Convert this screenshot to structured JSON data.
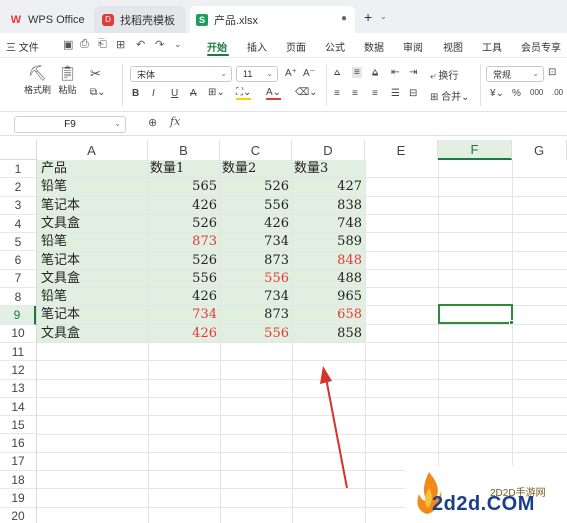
{
  "tabs": {
    "wps": "WPS Office",
    "template": "找稻壳模板",
    "file": "产品.xlsx",
    "file_badge": "S",
    "template_badge": "D",
    "wps_badge": "W",
    "new_tab": "+",
    "modified_dot": "●"
  },
  "menu": {
    "file": "三 文件",
    "items": [
      "开始",
      "插入",
      "页面",
      "公式",
      "数据",
      "审阅",
      "视图",
      "工具",
      "会员专享"
    ],
    "active": "开始"
  },
  "ribbon": {
    "format_painter": "格式刷",
    "paste": "粘贴",
    "font_name": "宋体",
    "font_size": "11",
    "number_format": "常规",
    "wrap_text": "换行",
    "merge": "合并",
    "bold": "B",
    "italic": "I",
    "underline": "U",
    "strike": "A",
    "percent": "%",
    "thousands": "000",
    "currency": "¥",
    "decimal": ".00"
  },
  "formula_bar": {
    "cell_ref": "F9",
    "fx": "fx",
    "value": ""
  },
  "columns": [
    "A",
    "B",
    "C",
    "D",
    "E",
    "F",
    "G"
  ],
  "selected_column": "F",
  "rows": [
    "1",
    "2",
    "3",
    "4",
    "5",
    "6",
    "7",
    "8",
    "9",
    "10",
    "11",
    "12",
    "13",
    "14",
    "15",
    "16",
    "17",
    "18",
    "19",
    "20"
  ],
  "selected_row": "9",
  "table": {
    "headers": [
      "产品",
      "数量1",
      "数量2",
      "数量3"
    ],
    "rows": [
      [
        "铅笔",
        "565",
        "526",
        "427"
      ],
      [
        "笔记本",
        "426",
        "556",
        "838"
      ],
      [
        "文具盒",
        "526",
        "426",
        "748"
      ],
      [
        "铅笔",
        "873",
        "734",
        "589"
      ],
      [
        "笔记本",
        "526",
        "873",
        "848"
      ],
      [
        "文具盒",
        "556",
        "556",
        "488"
      ],
      [
        "铅笔",
        "426",
        "734",
        "965"
      ],
      [
        "笔记本",
        "734",
        "873",
        "658"
      ],
      [
        "文具盒",
        "426",
        "556",
        "858"
      ]
    ]
  },
  "colors": {
    "accent": "#1c7a3f",
    "highlight_fill": "#e1efe1",
    "red_text": "#e53935",
    "purple_text": "#7d2a7d",
    "arrow": "#d8312a"
  },
  "watermark": {
    "small": "2D2D手游网",
    "big": "2d2d.COM"
  }
}
